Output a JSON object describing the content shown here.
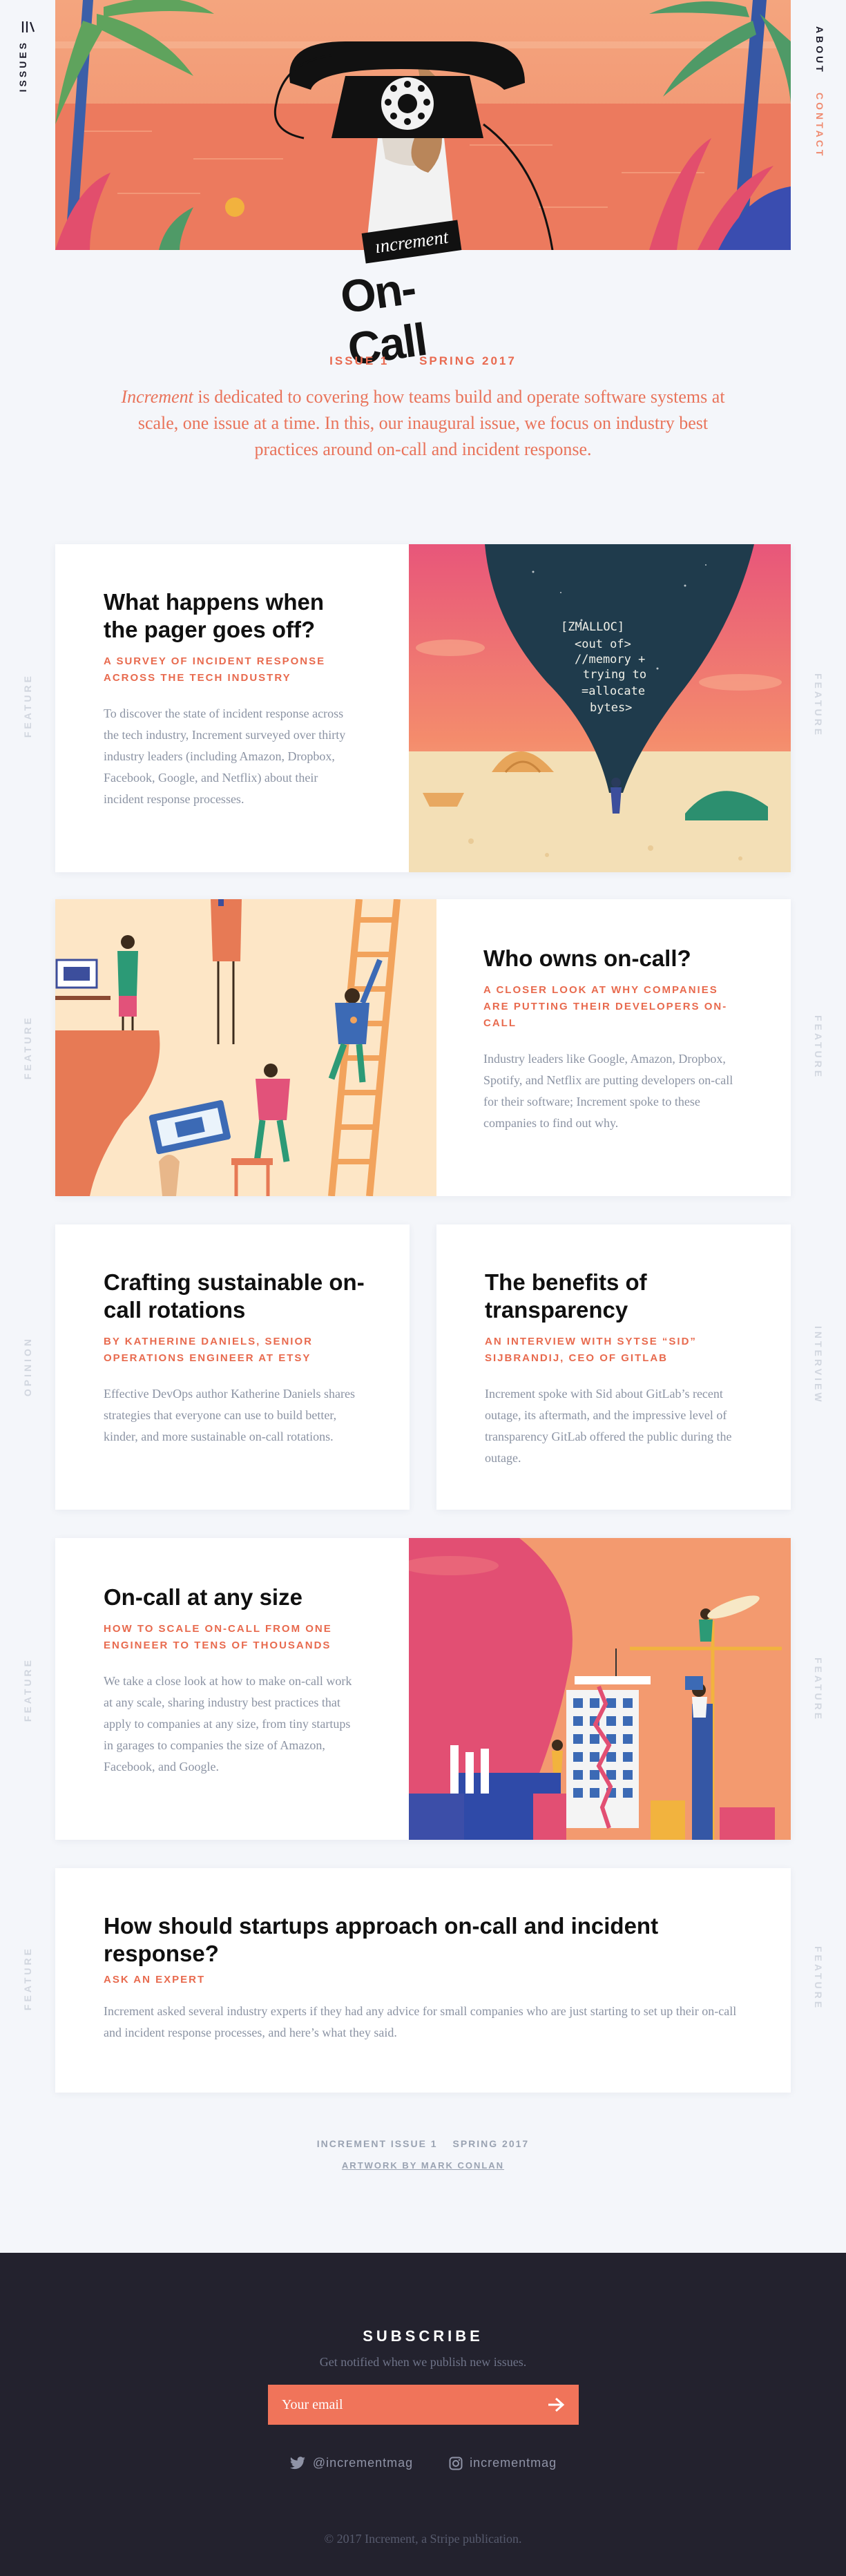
{
  "nav": {
    "issues_label": "ISSUES",
    "about_label": "ABOUT",
    "contact_label": "CONTACT"
  },
  "logo": {
    "flag_text": "ıncrement",
    "title": "On-Call"
  },
  "issue": {
    "number": "ISSUE 1",
    "season": "SPRING 2017"
  },
  "intro": {
    "brand": "Increment",
    "text": " is dedicated to covering how teams build and operate software systems at scale, one issue at a time. In this, our inaugural issue, we focus on industry best practices around on-call and incident response."
  },
  "articles": [
    {
      "category": "FEATURE",
      "title": "What happens when the pager goes off?",
      "kicker": "A SURVEY OF INCIDENT RESPONSE ACROSS THE TECH INDUSTRY",
      "summary": "To discover the state of incident response across the tech industry, Increment surveyed over thirty industry leaders (including Amazon, Dropbox, Facebook, Google, and Netflix) about their incident response processes.",
      "art_text": [
        "[ZMALLOC]",
        "<out of>",
        "//memory +",
        "trying to",
        "=allocate",
        "bytes>"
      ]
    },
    {
      "category": "FEATURE",
      "title": "Who owns on-call?",
      "kicker": "A CLOSER LOOK AT WHY COMPANIES ARE PUTTING THEIR DEVELOPERS ON-CALL",
      "summary": "Industry leaders like Google, Amazon, Dropbox, Spotify, and Netflix are putting developers on-call for their software; Increment spoke to these companies to find out why."
    },
    {
      "category": "OPINION",
      "title": "Crafting sustainable on-call rotations",
      "kicker": "BY KATHERINE DANIELS, SENIOR OPERATIONS ENGINEER AT ETSY",
      "summary": "Effective DevOps author Katherine Daniels shares strategies that everyone can use to build better, kinder, and more sustainable on-call rotations."
    },
    {
      "category": "INTERVIEW",
      "title": "The benefits of transparency",
      "kicker": "AN INTERVIEW WITH SYTSE “SID” SIJBRANDIJ, CEO OF GITLAB",
      "summary": "Increment spoke with Sid about GitLab’s recent outage, its aftermath, and the impressive level of transparency GitLab offered the public during the outage."
    },
    {
      "category": "FEATURE",
      "title": "On-call at any size",
      "kicker": "HOW TO SCALE ON-CALL FROM ONE ENGINEER TO TENS OF THOUSANDS",
      "summary": "We take a close look at how to make on-call work at any scale, sharing industry best practices that apply to companies at any size, from tiny startups in garages to companies the size of Amazon, Facebook, and Google."
    },
    {
      "category": "FEATURE",
      "title": "How should startups approach on-call and incident response?",
      "kicker": "ASK AN EXPERT",
      "summary": "Increment asked several industry experts if they had any advice for small companies who are just starting to set up their on-call and incident response processes, and here’s what they said."
    }
  ],
  "issue_footer": {
    "issue": "INCREMENT ISSUE 1",
    "season": "SPRING 2017",
    "artwork": "ARTWORK BY MARK CONLAN"
  },
  "footer": {
    "subscribe_title": "SUBSCRIBE",
    "subscribe_desc": "Get notified when we publish new issues.",
    "email_placeholder": "Your email",
    "twitter": "@incrementmag",
    "instagram": "incrementmag",
    "copyright": "© 2017 Increment, a Stripe publication."
  },
  "colors": {
    "accent": "#e96a50",
    "footer_bg": "#23222e",
    "page_bg": "#f4f6fa"
  }
}
